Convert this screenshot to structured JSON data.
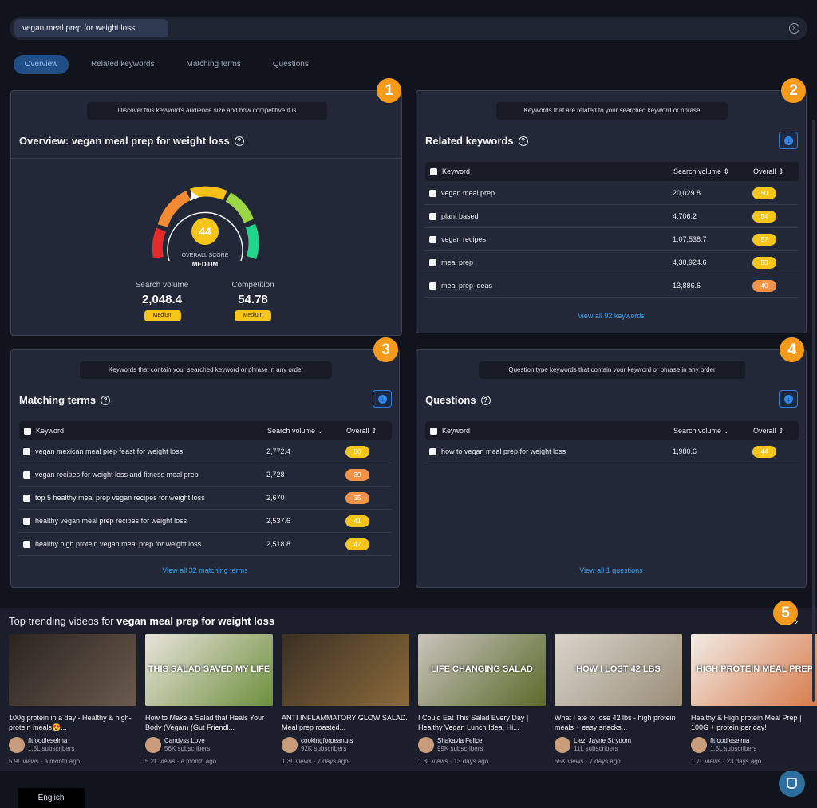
{
  "search": {
    "query": "vegan meal prep for weight loss"
  },
  "tabs": [
    {
      "label": "Overview",
      "active": true
    },
    {
      "label": "Related keywords",
      "active": false
    },
    {
      "label": "Matching terms",
      "active": false
    },
    {
      "label": "Questions",
      "active": false
    }
  ],
  "overview": {
    "badge": "1",
    "hint": "Discover this keyword's audience size and how competitive it is",
    "title": "Overview: vegan meal prep for weight loss",
    "score": "44",
    "score_label": "OVERALL SCORE",
    "score_level": "MEDIUM",
    "score_fraction": 0.44,
    "search_volume_label": "Search volume",
    "search_volume": "2,048.4",
    "search_volume_level": "Medium",
    "competition_label": "Competition",
    "competition": "54.78",
    "competition_level": "Medium"
  },
  "related": {
    "badge": "2",
    "hint": "Keywords that are related to your searched keyword or phrase",
    "title": "Related keywords",
    "columns": [
      "Keyword",
      "Search volume",
      "Overall"
    ],
    "rows": [
      {
        "keyword": "vegan meal prep",
        "volume": "20,029.8",
        "overall": "50",
        "tone": "y"
      },
      {
        "keyword": "plant based",
        "volume": "4,706.2",
        "overall": "54",
        "tone": "y"
      },
      {
        "keyword": "vegan recipes",
        "volume": "1,07,538.7",
        "overall": "57",
        "tone": "y"
      },
      {
        "keyword": "meal prep",
        "volume": "4,30,924.6",
        "overall": "53",
        "tone": "y"
      },
      {
        "keyword": "meal prep ideas",
        "volume": "13,886.6",
        "overall": "40",
        "tone": "o"
      }
    ],
    "view_all": "View all 92 keywords"
  },
  "matching": {
    "badge": "3",
    "hint": "Keywords that contain your searched keyword or phrase in any order",
    "title": "Matching terms",
    "columns": [
      "Keyword",
      "Search volume",
      "Overall"
    ],
    "rows": [
      {
        "keyword": "vegan mexican meal prep feast for weight loss",
        "volume": "2,772.4",
        "overall": "50",
        "tone": "y"
      },
      {
        "keyword": "vegan recipes for weight loss and fitness meal prep",
        "volume": "2,728",
        "overall": "39",
        "tone": "o"
      },
      {
        "keyword": "top 5 healthy meal prep vegan recipes for weight loss",
        "volume": "2,670",
        "overall": "35",
        "tone": "o"
      },
      {
        "keyword": "healthy vegan meal prep recipes for weight loss",
        "volume": "2,537.6",
        "overall": "41",
        "tone": "y"
      },
      {
        "keyword": "healthy high protein vegan meal prep for weight loss",
        "volume": "2,518.8",
        "overall": "47",
        "tone": "y"
      }
    ],
    "view_all": "View all 32 matching terms"
  },
  "questions": {
    "badge": "4",
    "hint": "Question type keywords that contain your keyword or phrase in any order",
    "title": "Questions",
    "columns": [
      "Keyword",
      "Search volume",
      "Overall"
    ],
    "rows": [
      {
        "keyword": "how to vegan meal prep for weight loss",
        "volume": "1,980.6",
        "overall": "44",
        "tone": "y"
      }
    ],
    "view_all": "View all 1 questions"
  },
  "trending": {
    "badge": "5",
    "title_prefix": "Top trending videos for ",
    "title_keyword": "vegan meal prep for weight loss",
    "videos": [
      {
        "title": "100g protein in a day - Healthy & high-protein meals😍...",
        "channel": "fitfoodieselma",
        "subs": "1.5L subscribers",
        "meta": "5.9L views · a month ago",
        "overlay": "",
        "colors": [
          "#2a2420",
          "#6b5a4e"
        ]
      },
      {
        "title": "How to Make a Salad that Heals Your Body (Vegan) (Gut Friendl...",
        "channel": "Candyss Love",
        "subs": "56K subscribers",
        "meta": "5.2L views · a month ago",
        "overlay": "THIS SALAD SAVED MY LIFE",
        "colors": [
          "#e8e4dc",
          "#6d8f3c"
        ]
      },
      {
        "title": "ANTI INFLAMMATORY GLOW SALAD. Meal prep roasted...",
        "channel": "cookingforpeanuts",
        "subs": "92K subscribers",
        "meta": "1.3L views · 7 days ago",
        "overlay": "",
        "colors": [
          "#3a3024",
          "#8a6a3a"
        ]
      },
      {
        "title": "I Could Eat This Salad Every Day | Healthy Vegan Lunch Idea, Hi...",
        "channel": "Shakayla Felice",
        "subs": "99K subscribers",
        "meta": "1.3L views · 13 days ago",
        "overlay": "LIFE CHANGING SALAD",
        "colors": [
          "#c9c4bd",
          "#5a6b2a"
        ]
      },
      {
        "title": "What I ate to lose 42 lbs - high protein meals + easy snacks...",
        "channel": "Liezl Jayne Strydom",
        "subs": "11L subscribers",
        "meta": "55K views · 7 days ago",
        "overlay": "HOW I LOST 42 LBS",
        "colors": [
          "#d9d4cc",
          "#9a8e78"
        ]
      },
      {
        "title": "Healthy & High protein Meal Prep | 100G + protein per day!",
        "channel": "fitfoodieselma",
        "subs": "1.5L subscribers",
        "meta": "1.7L views · 23 days ago",
        "overlay": "HIGH PROTEIN MEAL PREP",
        "colors": [
          "#f1ece6",
          "#d87a4a"
        ]
      }
    ]
  },
  "footer": {
    "language": "English"
  }
}
